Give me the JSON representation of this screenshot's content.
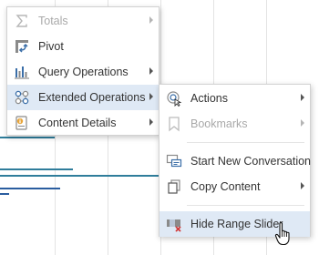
{
  "colors": {
    "accent": "#3a6ea8",
    "bar_teal": "#2f7d9b",
    "bar_blue": "#2a5d9f",
    "highlight": "#dfe9f5",
    "disabled_text": "#a9a9a9"
  },
  "main_menu": {
    "items": [
      {
        "label": "Totals",
        "icon": "sigma-icon",
        "enabled": false,
        "submenu": true
      },
      {
        "label": "Pivot",
        "icon": "pivot-icon",
        "enabled": true,
        "submenu": false
      },
      {
        "label": "Query Operations",
        "icon": "bar-chart-icon",
        "enabled": true,
        "submenu": true
      },
      {
        "label": "Extended Operations",
        "icon": "network-nodes-icon",
        "enabled": true,
        "submenu": true,
        "highlighted": true
      },
      {
        "label": "Content Details",
        "icon": "info-document-icon",
        "enabled": true,
        "submenu": true
      }
    ]
  },
  "sub_menu": {
    "items": [
      {
        "label": "Actions",
        "icon": "actions-icon",
        "enabled": true,
        "submenu": true
      },
      {
        "label": "Bookmarks",
        "icon": "bookmark-icon",
        "enabled": false,
        "submenu": true
      },
      {
        "label": "Start New Conversation",
        "icon": "conversation-icon",
        "enabled": true,
        "submenu": false
      },
      {
        "label": "Copy Content",
        "icon": "copy-icon",
        "enabled": true,
        "submenu": true
      },
      {
        "label": "Hide Range Slider",
        "icon": "range-slider-icon",
        "enabled": true,
        "submenu": false,
        "highlighted": true
      }
    ]
  }
}
